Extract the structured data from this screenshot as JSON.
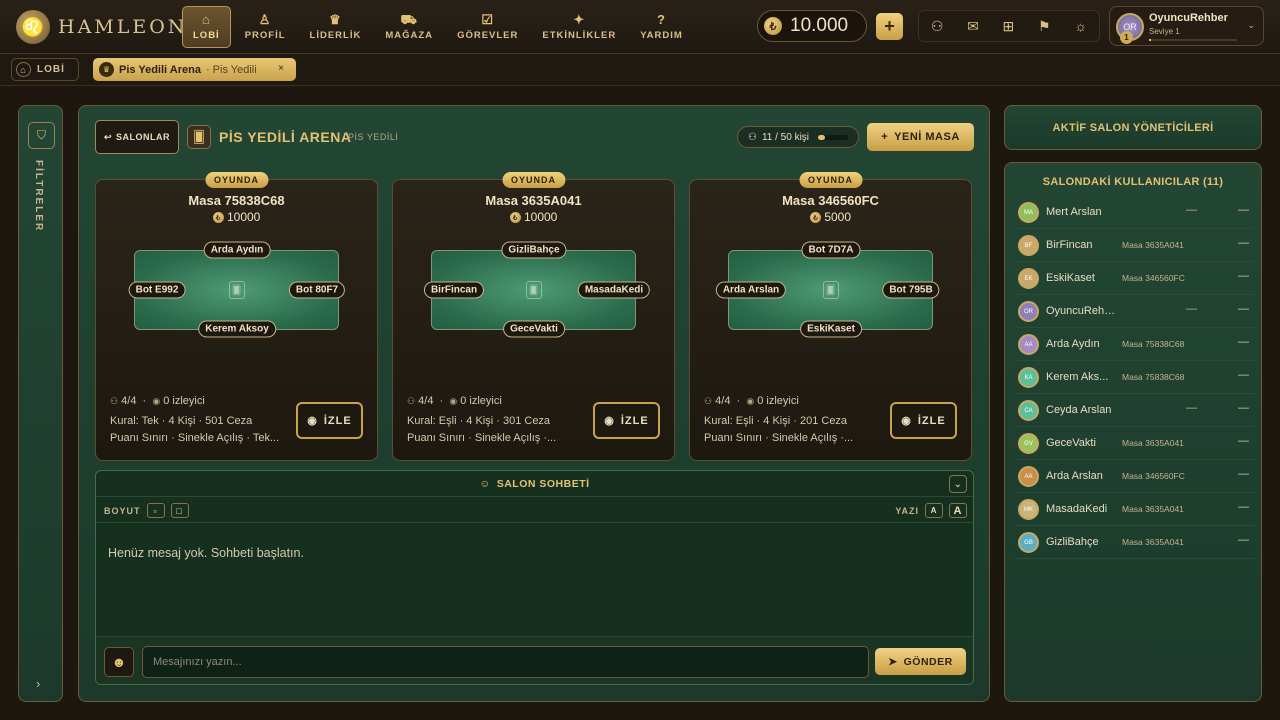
{
  "brand": {
    "name": "HAMLEON"
  },
  "nav": [
    {
      "label": "LOBİ",
      "icon": "home-icon",
      "glyph": "⌂",
      "active": true
    },
    {
      "label": "PROFİL",
      "icon": "user-icon",
      "glyph": "♙"
    },
    {
      "label": "LİDERLİK",
      "icon": "trophy-icon",
      "glyph": "♛"
    },
    {
      "label": "MAĞAZA",
      "icon": "cart-icon",
      "glyph": "⛟"
    },
    {
      "label": "GÖREVLER",
      "icon": "clipboard-icon",
      "glyph": "☑"
    },
    {
      "label": "ETKİNLİKLER",
      "icon": "gift-icon",
      "glyph": "✦"
    },
    {
      "label": "YARDIM",
      "icon": "help-icon",
      "glyph": "?"
    }
  ],
  "wallet": {
    "coins": "10.000",
    "add_label": "+"
  },
  "header_icons": [
    "friends-icon",
    "mail-icon",
    "gift-icon",
    "flag-icon",
    "settings-icon"
  ],
  "user": {
    "name": "OyuncuRehber",
    "level": "Seviye 1",
    "level_number": "1",
    "initials": "OR",
    "xp_fraction": 0.02
  },
  "breadcrumb": {
    "home_label": "LOBİ",
    "tab_title": "Pis Yedili Arena",
    "tab_sub": "· Pis Yedili",
    "close": "×"
  },
  "filters": {
    "label": "FİLTRELER",
    "expand": "›"
  },
  "salon": {
    "back_label": "SALONLAR",
    "title": "PİS YEDİLİ ARENA",
    "subtitle": "PİS YEDİLİ",
    "capacity_label": "11 / 50 kişi",
    "capacity_fraction": 0.22,
    "new_table_label": "YENİ MASA"
  },
  "tables": [
    {
      "status": "OYUNDA",
      "title": "Masa 75838C68",
      "bet": "10000",
      "seats": {
        "top": "Arda Aydın",
        "left": "Bot E992",
        "right": "Bot 80F7",
        "bottom": "Kerem Aksoy"
      },
      "players": "4/4",
      "spectators": "0 izleyici",
      "rule": "Kural: Tek · 4 Kişi · 501 Ceza",
      "rule2": "Puanı Sınırı · Sinekle Açılış · Tek...",
      "watch_label": "İZLE"
    },
    {
      "status": "OYUNDA",
      "title": "Masa 3635A041",
      "bet": "10000",
      "seats": {
        "top": "GizliBahçe",
        "left": "BirFincan",
        "right": "MasadaKedi",
        "bottom": "GeceVakti"
      },
      "players": "4/4",
      "spectators": "0 izleyici",
      "rule": "Kural: Eşli · 4 Kişi · 301 Ceza",
      "rule2": "Puanı Sınırı · Sinekle Açılış ·...",
      "watch_label": "İZLE"
    },
    {
      "status": "OYUNDA",
      "title": "Masa 346560FC",
      "bet": "5000",
      "seats": {
        "top": "Bot 7D7A",
        "left": "Arda Arslan",
        "right": "Bot 795B",
        "bottom": "EskiKaset"
      },
      "players": "4/4",
      "spectators": "0 izleyici",
      "rule": "Kural: Eşli · 4 Kişi · 201 Ceza",
      "rule2": "Puanı Sınırı · Sinekle Açılış ·...",
      "watch_label": "İZLE"
    }
  ],
  "chat": {
    "title": "SALON SOHBETİ",
    "size_label": "BOYUT",
    "font_label": "YAZI",
    "font_small": "A",
    "font_large": "A",
    "empty_text": "Henüz mesaj yok. Sohbeti başlatın.",
    "placeholder": "Mesajınızı yazın...",
    "send_label": "GÖNDER"
  },
  "managers": {
    "title": "AKTİF SALON YÖNETİCİLERİ"
  },
  "users": {
    "title": "SALONDAKİ KULLANICILAR (11)",
    "list": [
      {
        "initials": "MA",
        "name": "Mert Arslan",
        "table": "—",
        "color": "#8fbf5a",
        "action": "—"
      },
      {
        "initials": "BF",
        "name": "BirFincan",
        "table": "Masa 3635A041",
        "color": "#c9a86a",
        "action": "—"
      },
      {
        "initials": "EK",
        "name": "EskiKaset",
        "table": "Masa 346560FC",
        "color": "#c9a86a",
        "action": "—"
      },
      {
        "initials": "OR",
        "name": "OyuncuRehber",
        "table": "—",
        "color": "#8f7fb8",
        "action": "—"
      },
      {
        "initials": "AA",
        "name": "Arda Aydın",
        "table": "Masa 75838C68",
        "color": "#a68bc2",
        "action": "—"
      },
      {
        "initials": "KA",
        "name": "Kerem Aks...",
        "table": "Masa 75838C68",
        "color": "#5bbf9a",
        "action": "—"
      },
      {
        "initials": "CA",
        "name": "Ceyda Arslan",
        "table": "—",
        "color": "#5bbf9a",
        "action": "—"
      },
      {
        "initials": "GV",
        "name": "GeceVakti",
        "table": "Masa 3635A041",
        "color": "#9cc25a",
        "action": "—"
      },
      {
        "initials": "AA",
        "name": "Arda Arslan",
        "table": "Masa 346560FC",
        "color": "#c98f4a",
        "action": "—"
      },
      {
        "initials": "MK",
        "name": "MasadaKedi",
        "table": "Masa 3635A041",
        "color": "#c9b47a",
        "action": "—"
      },
      {
        "initials": "GB",
        "name": "GizliBahçe",
        "table": "Masa 3635A041",
        "color": "#5ab0c2",
        "action": "—"
      }
    ]
  }
}
